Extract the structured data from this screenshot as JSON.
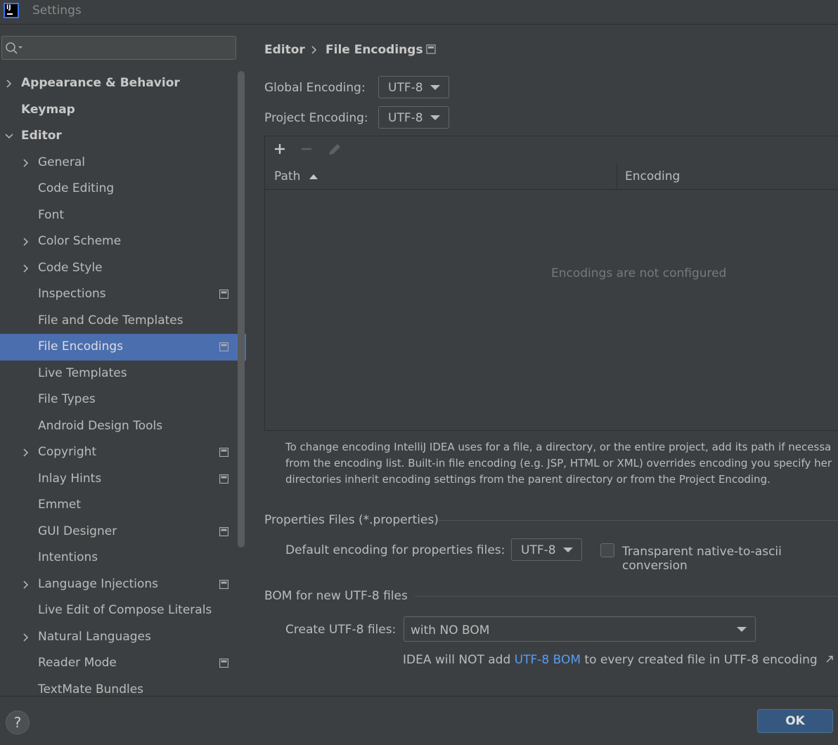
{
  "window": {
    "title": "Settings",
    "logo_text": "IJ"
  },
  "search": {
    "value": "",
    "placeholder": ""
  },
  "sidebar": {
    "items": [
      {
        "label": "Appearance & Behavior",
        "level": 0,
        "expandable": true,
        "expanded": false,
        "bold": true,
        "project_icon": false
      },
      {
        "label": "Keymap",
        "level": 0,
        "expandable": false,
        "bold": true,
        "project_icon": false
      },
      {
        "label": "Editor",
        "level": 0,
        "expandable": true,
        "expanded": true,
        "bold": true,
        "project_icon": false
      },
      {
        "label": "General",
        "level": 1,
        "expandable": true,
        "expanded": false,
        "project_icon": false
      },
      {
        "label": "Code Editing",
        "level": 1,
        "expandable": false,
        "project_icon": false
      },
      {
        "label": "Font",
        "level": 1,
        "expandable": false,
        "project_icon": false
      },
      {
        "label": "Color Scheme",
        "level": 1,
        "expandable": true,
        "expanded": false,
        "project_icon": false
      },
      {
        "label": "Code Style",
        "level": 1,
        "expandable": true,
        "expanded": false,
        "project_icon": false
      },
      {
        "label": "Inspections",
        "level": 1,
        "expandable": false,
        "project_icon": true
      },
      {
        "label": "File and Code Templates",
        "level": 1,
        "expandable": false,
        "project_icon": false
      },
      {
        "label": "File Encodings",
        "level": 1,
        "expandable": false,
        "project_icon": true,
        "selected": true
      },
      {
        "label": "Live Templates",
        "level": 1,
        "expandable": false,
        "project_icon": false
      },
      {
        "label": "File Types",
        "level": 1,
        "expandable": false,
        "project_icon": false
      },
      {
        "label": "Android Design Tools",
        "level": 1,
        "expandable": false,
        "project_icon": false
      },
      {
        "label": "Copyright",
        "level": 1,
        "expandable": true,
        "expanded": false,
        "project_icon": true
      },
      {
        "label": "Inlay Hints",
        "level": 1,
        "expandable": false,
        "project_icon": true
      },
      {
        "label": "Emmet",
        "level": 1,
        "expandable": false,
        "project_icon": false
      },
      {
        "label": "GUI Designer",
        "level": 1,
        "expandable": false,
        "project_icon": true
      },
      {
        "label": "Intentions",
        "level": 1,
        "expandable": false,
        "project_icon": false
      },
      {
        "label": "Language Injections",
        "level": 1,
        "expandable": true,
        "expanded": false,
        "project_icon": true
      },
      {
        "label": "Live Edit of Compose Literals",
        "level": 1,
        "expandable": false,
        "project_icon": false
      },
      {
        "label": "Natural Languages",
        "level": 1,
        "expandable": true,
        "expanded": false,
        "project_icon": false
      },
      {
        "label": "Reader Mode",
        "level": 1,
        "expandable": false,
        "project_icon": true
      },
      {
        "label": "TextMate Bundles",
        "level": 1,
        "expandable": false,
        "project_icon": false
      }
    ]
  },
  "breadcrumb": {
    "parent": "Editor",
    "current": "File Encodings"
  },
  "global_encoding": {
    "label": "Global Encoding:",
    "value": "UTF-8"
  },
  "project_encoding": {
    "label": "Project Encoding:",
    "value": "UTF-8"
  },
  "table": {
    "columns": [
      "Path",
      "Encoding"
    ],
    "empty_text": "Encodings are not configured"
  },
  "help_text": [
    "To change encoding IntelliJ IDEA uses for a file, a directory, or the entire project, add its path if necessa",
    "from the encoding list. Built-in file encoding (e.g. JSP, HTML or XML) overrides encoding you specify her",
    "directories inherit encoding settings from the parent directory or from the Project Encoding."
  ],
  "properties_section": {
    "title": "Properties Files (*.properties)",
    "default_label": "Default encoding for properties files:",
    "default_value": "UTF-8",
    "checkbox_label": "Transparent native-to-ascii conversion",
    "checkbox_checked": false
  },
  "bom_section": {
    "title": "BOM for new UTF-8 files",
    "create_label": "Create UTF-8 files:",
    "create_value": "with NO BOM",
    "note_prefix": "IDEA will NOT add ",
    "note_link": "UTF-8 BOM",
    "note_suffix": " to every created file in UTF-8 encoding"
  },
  "footer": {
    "help_label": "?",
    "ok_label": "OK"
  },
  "colors": {
    "background": "#3c3f41",
    "selection": "#4b6eaf",
    "link": "#589df6",
    "ok_button": "#365880"
  }
}
